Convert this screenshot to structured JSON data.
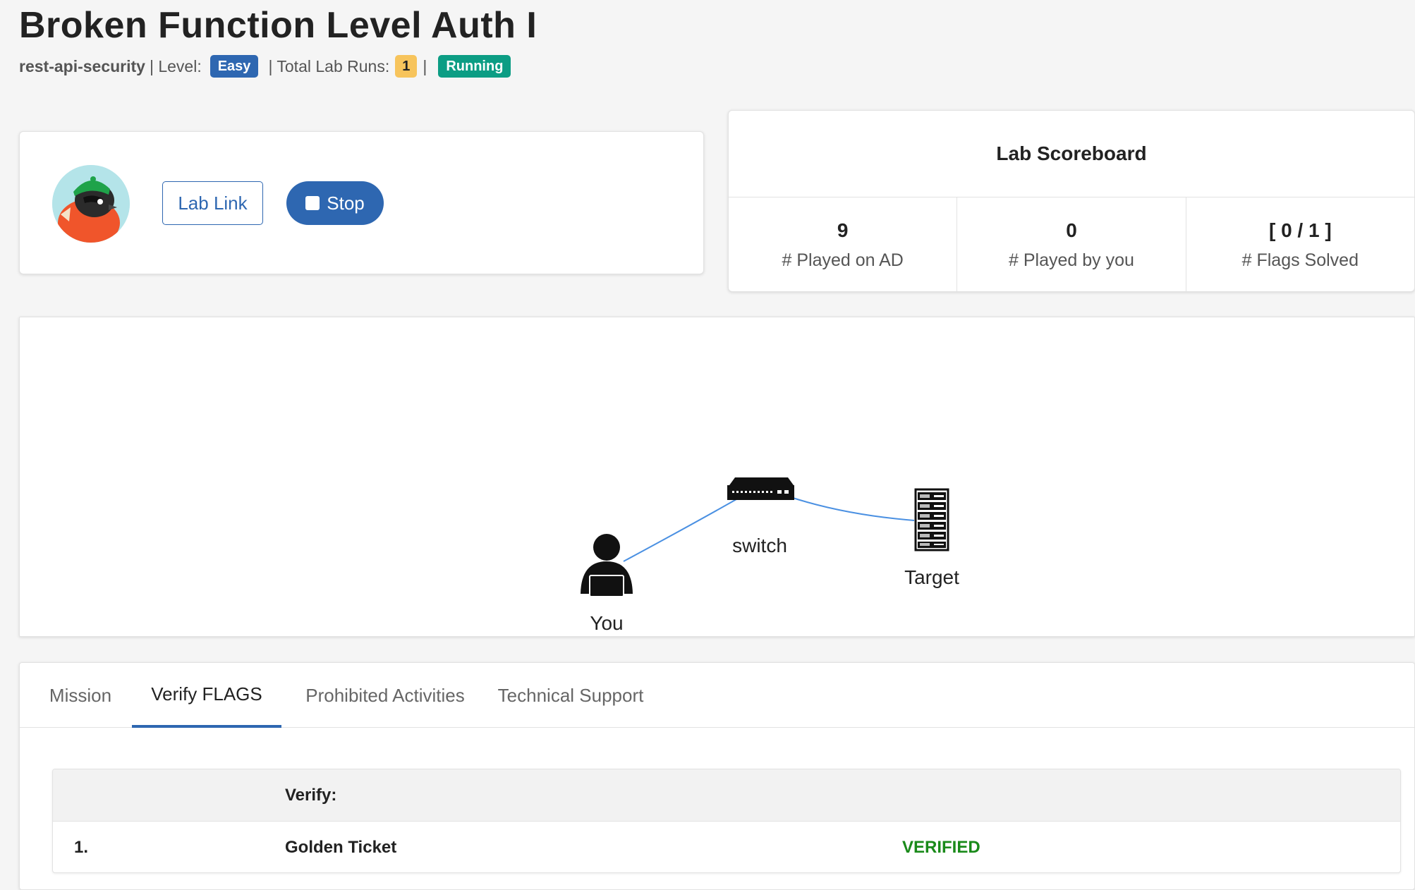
{
  "header": {
    "title": "Broken Function Level Auth I",
    "course": "rest-api-security",
    "level_label": "| Level:",
    "level_value": "Easy",
    "runs_label": "| Total Lab Runs:",
    "runs_value": "1",
    "runs_sep": "|",
    "status": "Running"
  },
  "lab_controls": {
    "lab_link_label": "Lab Link",
    "stop_label": "Stop"
  },
  "scoreboard": {
    "title": "Lab Scoreboard",
    "stats": [
      {
        "value": "9",
        "label": "# Played on AD"
      },
      {
        "value": "0",
        "label": "# Played by you"
      },
      {
        "value": "[ 0 / 1 ]",
        "label": "# Flags Solved"
      }
    ]
  },
  "topology": {
    "nodes": [
      {
        "id": "you",
        "label": "You",
        "icon": "user-laptop-icon"
      },
      {
        "id": "switch",
        "label": "switch",
        "icon": "network-switch-icon"
      },
      {
        "id": "target",
        "label": "Target",
        "icon": "server-rack-icon"
      }
    ],
    "link_color": "#4a90e2"
  },
  "tabs": [
    {
      "label": "Mission",
      "active": false
    },
    {
      "label": "Verify FLAGS",
      "active": true
    },
    {
      "label": "Prohibited Activities",
      "active": false
    },
    {
      "label": "Technical Support",
      "active": false
    }
  ],
  "verify_table": {
    "header": "Verify:",
    "rows": [
      {
        "index": "1.",
        "name": "Golden Ticket",
        "status": "VERIFIED"
      }
    ]
  },
  "colors": {
    "primary": "#2e67b1",
    "running": "#0c9d84",
    "runs_badge": "#f7c45c",
    "verified": "#1a8a1a"
  }
}
